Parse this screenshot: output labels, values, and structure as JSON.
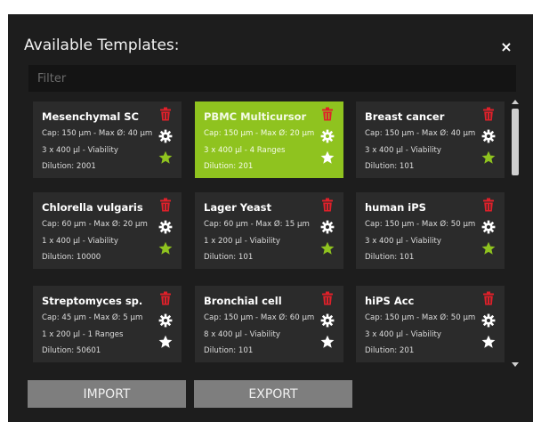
{
  "dialog": {
    "title": "Available Templates:",
    "close_label": "×",
    "filter": {
      "placeholder": "Filter",
      "value": ""
    }
  },
  "colors": {
    "background": "#1d1d1d",
    "card": "#2b2b2b",
    "selected": "#8fc31f",
    "trash": "#e0202a",
    "star_favorite": "#8fc31f",
    "star_default": "#ffffff",
    "button": "#7e7e7e"
  },
  "templates": [
    {
      "name": "Mesenchymal SC",
      "cap": "Cap: 150 µm - Max Ø: 40 µm",
      "volume": "3 x 400 µl - Viability",
      "dilution": "Dilution: 2001",
      "favorite": true,
      "selected": false
    },
    {
      "name": "PBMC Multicursor",
      "cap": "Cap: 150 µm - Max Ø: 20 µm",
      "volume": "3 x 400 µl - 4 Ranges",
      "dilution": "Dilution: 201",
      "favorite": false,
      "selected": true
    },
    {
      "name": "Breast cancer",
      "cap": "Cap: 150 µm - Max Ø: 40 µm",
      "volume": "3 x 400 µl - Viability",
      "dilution": "Dilution: 101",
      "favorite": true,
      "selected": false
    },
    {
      "name": "Chlorella vulgaris",
      "cap": "Cap: 60 µm - Max Ø: 20 µm",
      "volume": "1 x 400 µl - Viability",
      "dilution": "Dilution: 10000",
      "favorite": true,
      "selected": false
    },
    {
      "name": "Lager Yeast",
      "cap": "Cap: 60 µm - Max Ø: 15 µm",
      "volume": "1 x 200 µl - Viability",
      "dilution": "Dilution: 101",
      "favorite": true,
      "selected": false
    },
    {
      "name": "human iPS",
      "cap": "Cap: 150 µm - Max Ø: 50 µm",
      "volume": "3 x 400 µl - Viability",
      "dilution": "Dilution: 101",
      "favorite": true,
      "selected": false
    },
    {
      "name": "Streptomyces sp.",
      "cap": "Cap: 45 µm - Max Ø: 5 µm",
      "volume": "1 x 200 µl - 1 Ranges",
      "dilution": "Dilution: 50601",
      "favorite": false,
      "selected": false
    },
    {
      "name": "Bronchial cell",
      "cap": "Cap: 150 µm - Max Ø: 60 µm",
      "volume": "8 x 400 µl - Viability",
      "dilution": "Dilution: 101",
      "favorite": false,
      "selected": false
    },
    {
      "name": "hiPS Acc",
      "cap": "Cap: 150 µm - Max Ø: 50 µm",
      "volume": "3 x 400 µl - Viability",
      "dilution": "Dilution: 201",
      "favorite": false,
      "selected": false
    }
  ],
  "icons": {
    "delete": "trash-icon",
    "settings": "gear-icon",
    "favorite": "star-icon",
    "close": "close-icon"
  },
  "buttons": {
    "import_label": "IMPORT",
    "export_label": "EXPORT"
  }
}
